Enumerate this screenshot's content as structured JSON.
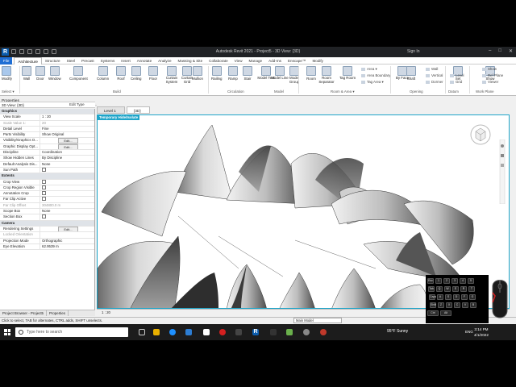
{
  "app": {
    "title": "Autodesk Revit 2021 - Project5 - 3D View: {3D}",
    "sign_in": "Sign In"
  },
  "tabs": [
    "File",
    "Architecture",
    "Structure",
    "Steel",
    "Precast",
    "Systems",
    "Insert",
    "Annotate",
    "Analyze",
    "Massing & Site",
    "Collaborate",
    "View",
    "Manage",
    "Add-Ins",
    "Enscape™",
    "Modify"
  ],
  "active_tab": "Architecture",
  "ribbon": {
    "tools": [
      "Modify",
      "Wall",
      "Door",
      "Window",
      "Component",
      "Column",
      "Roof",
      "Ceiling",
      "Floor",
      "Curtain System",
      "Curtain Grid",
      "Mullion",
      "Railing",
      "Ramp",
      "Stair",
      "Model Text",
      "Model Line",
      "Model Group",
      "Room",
      "Room Separator",
      "Tag Room",
      "By Face",
      "Shaft",
      "Set",
      "Show",
      "Ref Plane",
      "Viewer"
    ],
    "small_tools": [
      "Area ▾",
      "Area Boundary",
      "Tag Area ▾",
      "Wall",
      "Vertical",
      "Dormer",
      "Level",
      "Grid"
    ],
    "groups": [
      "Select ▾",
      "Build",
      "Circulation",
      "Model",
      "Room & Area ▾",
      "Opening",
      "Datum",
      "Work Plane"
    ]
  },
  "properties": {
    "header": "Properties",
    "type_selector": "3D View: {3D}",
    "edit_type": "Edit Type",
    "rows": [
      {
        "cat": "Graphics"
      },
      {
        "k": "View Scale",
        "v": "1 : 20"
      },
      {
        "k": "Scale Value    1:",
        "v": "20",
        "grey": true
      },
      {
        "k": "Detail Level",
        "v": "Fine"
      },
      {
        "k": "Parts Visibility",
        "v": "Show Original"
      },
      {
        "k": "Visibility/Graphics O...",
        "btn": "Edit..."
      },
      {
        "k": "Graphic Display Opt...",
        "btn": "Edit..."
      },
      {
        "k": "Discipline",
        "v": "Coordination"
      },
      {
        "k": "Show Hidden Lines",
        "v": "By Discipline"
      },
      {
        "k": "Default Analysis Dis...",
        "v": "None"
      },
      {
        "k": "Sun Path",
        "chk": true
      },
      {
        "cat": "Extents"
      },
      {
        "k": "Crop View",
        "chk": true
      },
      {
        "k": "Crop Region Visible",
        "chk": true
      },
      {
        "k": "Annotation Crop",
        "chk": true
      },
      {
        "k": "Far Clip Active",
        "chk": true
      },
      {
        "k": "Far Clip Offset",
        "v": "304800.0 m",
        "grey": true
      },
      {
        "k": "Scope Box",
        "v": "None"
      },
      {
        "k": "Section Box",
        "chk": true
      },
      {
        "cat": "Camera"
      },
      {
        "k": "Rendering Settings",
        "btn": "Edit..."
      },
      {
        "k": "Locked Orientation",
        "v": "",
        "grey": true
      },
      {
        "k": "Projection Mode",
        "v": "Orthographic"
      },
      {
        "k": "Eye Elevation",
        "v": "62.9539 m"
      }
    ],
    "bottom_tabs": [
      "Project Browser - Project5",
      "Properties"
    ]
  },
  "view_tabs": [
    "Level 1",
    "{3D}"
  ],
  "viewport": {
    "hide_label": "Temporary Hide/Isolate",
    "scale": "1 : 20"
  },
  "status": {
    "text": "Click to select, TAB for alternates, CTRL adds, SHIFT unselects.",
    "model": "Main Model"
  },
  "taskbar": {
    "search": "Type here to search",
    "weather": "95°F  Sunny",
    "lang": "ENG",
    "time": "3:14 PM",
    "date": "4/1/2022"
  },
  "keys": [
    "Esc",
    "1",
    "2",
    "3",
    "4",
    "5",
    "Tab",
    "Q",
    "W",
    "E",
    "R",
    "T",
    "Caps",
    "A",
    "S",
    "D",
    "F",
    "G",
    "Shift",
    "Z",
    "X",
    "C",
    "V",
    "B",
    "Ctrl",
    "Alt"
  ],
  "colors": {
    "accent": "#1fa5c9",
    "file_tab": "#1f6ed4",
    "taskbar": "#1c1c1c"
  }
}
